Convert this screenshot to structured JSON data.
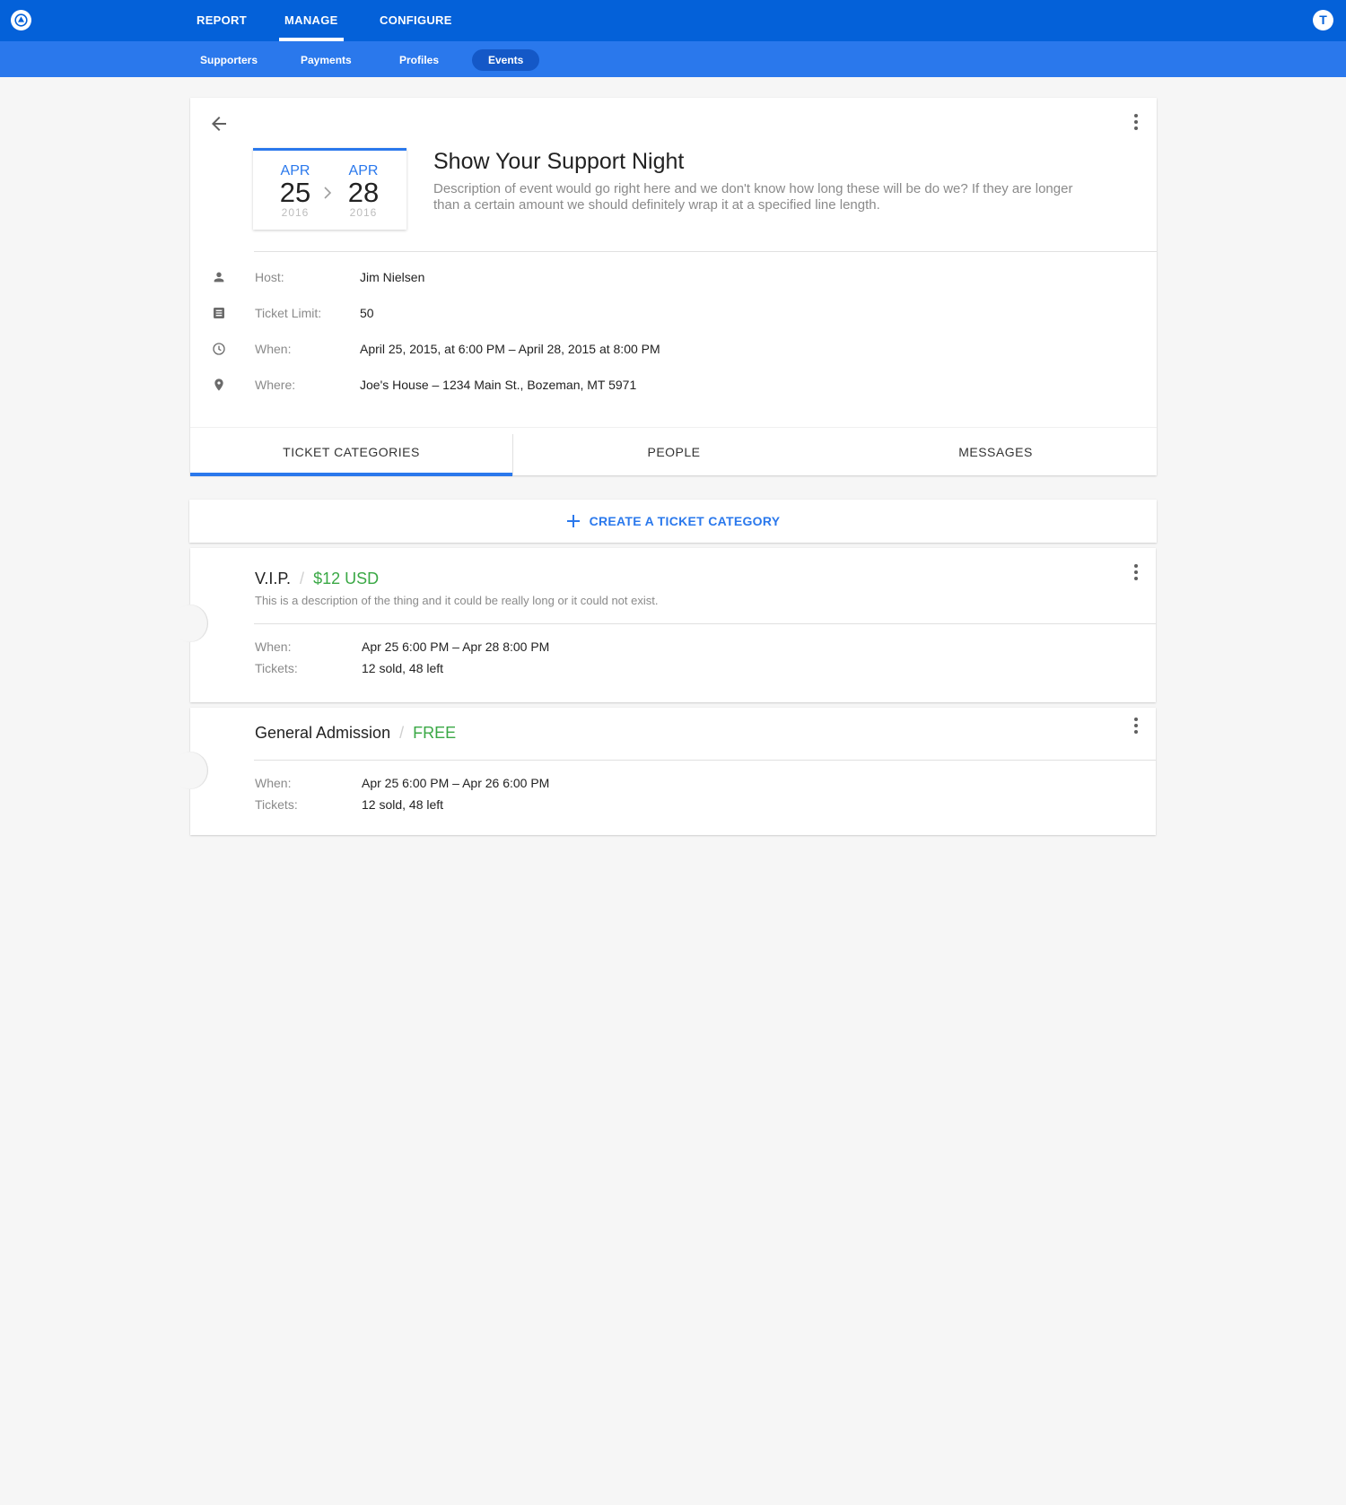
{
  "topnav": {
    "items": [
      "REPORT",
      "MANAGE",
      "CONFIGURE"
    ],
    "active": "MANAGE",
    "user_initial": "T"
  },
  "subnav": {
    "items": [
      "Supporters",
      "Payments",
      "Profiles",
      "Events"
    ],
    "active": "Events"
  },
  "event": {
    "start": {
      "month": "APR",
      "day": "25",
      "year": "2016"
    },
    "end": {
      "month": "APR",
      "day": "28",
      "year": "2016"
    },
    "title": "Show Your Support Night",
    "description": "Description of event would go right here and we don't know how long these will be do we? If they are longer than a certain amount we should definitely wrap it at a specified line length.",
    "details": [
      {
        "icon": "person-icon",
        "label": "Host:",
        "value": "Jim Nielsen"
      },
      {
        "icon": "ticket-limit-icon",
        "label": "Ticket Limit:",
        "value": "50"
      },
      {
        "icon": "clock-icon",
        "label": "When:",
        "value": "April 25, 2015, at 6:00 PM – April 28, 2015 at 8:00 PM"
      },
      {
        "icon": "location-pin-icon",
        "label": "Where:",
        "value": "Joe's House – 1234 Main St., Bozeman, MT 5971"
      }
    ]
  },
  "tabs": [
    "TICKET CATEGORIES",
    "PEOPLE",
    "MESSAGES"
  ],
  "active_tab": "TICKET CATEGORIES",
  "create_button": "CREATE A TICKET CATEGORY",
  "ticket_categories": [
    {
      "name": "V.I.P.",
      "price": "$12 USD",
      "description": "This is a description of the thing and it could be really long or it could not exist.",
      "when_label": "When:",
      "when": "Apr 25 6:00 PM – Apr 28 8:00 PM",
      "tickets_label": "Tickets:",
      "tickets": "12 sold, 48 left"
    },
    {
      "name": "General Admission",
      "price": "FREE",
      "description": "",
      "when_label": "When:",
      "when": "Apr 25 6:00 PM – Apr 26 6:00 PM",
      "tickets_label": "Tickets:",
      "tickets": "12 sold, 48 left"
    }
  ],
  "colors": {
    "topbar": "#0461d9",
    "subbar": "#2a78ec",
    "accent": "#2a78ec",
    "price": "#3aa845",
    "background": "#f6f6f6"
  }
}
